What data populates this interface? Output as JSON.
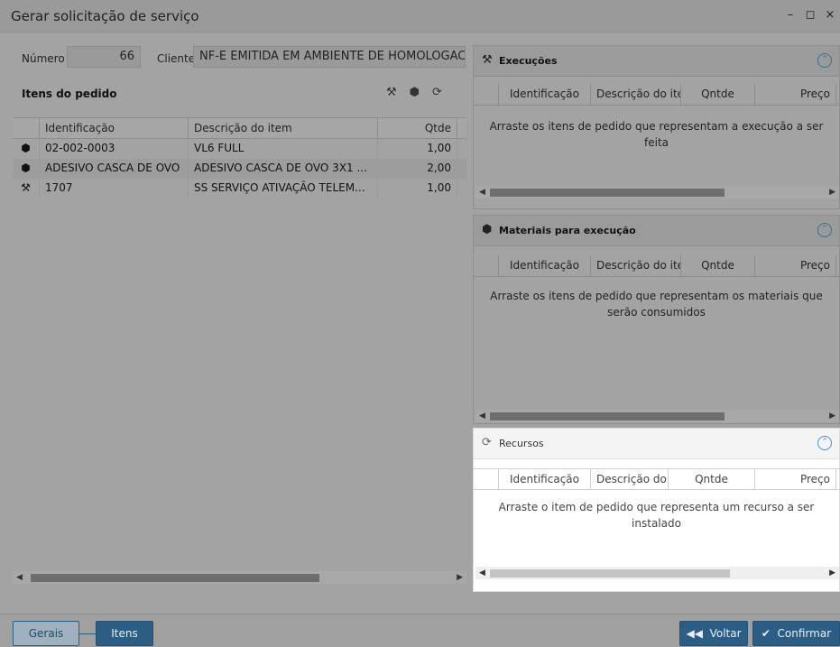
{
  "window": {
    "title": "Gerar solicitação de serviço",
    "minimize_glyph": "–",
    "restore_glyph": "◻",
    "close_glyph": "×"
  },
  "header": {
    "numero_label": "Número",
    "numero_value": "66",
    "cliente_label": "Cliente",
    "cliente_value": "NF-E EMITIDA EM AMBIENTE DE HOMOLOGACAO"
  },
  "items_panel": {
    "title": "Itens do pedido",
    "toolbar_icons": [
      "tools-icon",
      "box-icon",
      "recycle-icon"
    ],
    "columns": [
      "Identificação",
      "Descrição do item",
      "Qtde"
    ],
    "rows": [
      {
        "icon": "box-icon",
        "id": "02-002-0003",
        "desc": "VL6 FULL",
        "qtde": "1,00"
      },
      {
        "icon": "box-icon",
        "id": "ADESIVO CASCA DE OVO",
        "desc": "ADESIVO CASCA DE OVO 3X1 ...",
        "qtde": "2,00"
      },
      {
        "icon": "tools-icon",
        "id": "1707",
        "desc": "SS SERVIÇO ATIVAÇÃO TELEM...",
        "qtde": "1,00"
      }
    ]
  },
  "execucoes": {
    "title": "Execuções",
    "columns": [
      "Identificação",
      "Descrição do item",
      "Qntde",
      "Preço"
    ],
    "empty_message": "Arraste os itens de pedido que representam a execução a ser feita"
  },
  "materiais": {
    "title": "Materiais para execução",
    "columns": [
      "Identificação",
      "Descrição do item",
      "Qntde",
      "Preço"
    ],
    "empty_message": "Arraste os itens de pedido que representam os materiais que serão consumidos"
  },
  "recursos": {
    "title": "Recursos",
    "columns": [
      "Identificação",
      "Descrição do item",
      "Qntde",
      "Preço"
    ],
    "empty_message": "Arraste o item de pedido que representa um recurso a ser instalado"
  },
  "footer": {
    "tab_gerais": "Gerais",
    "tab_itens": "Itens",
    "voltar": "Voltar",
    "confirmar": "Confirmar"
  },
  "colors": {
    "accent": "#2c5d85",
    "overlay_gray": "#a3a3a3"
  }
}
